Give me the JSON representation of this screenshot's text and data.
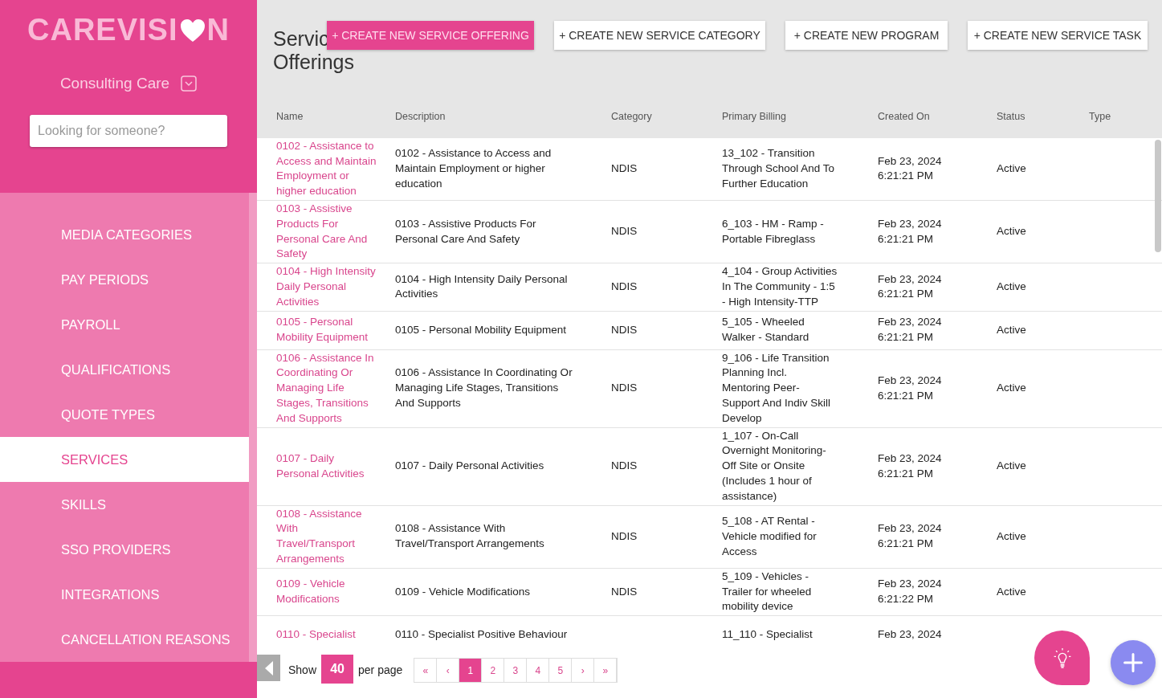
{
  "sidebar": {
    "logo": {
      "text_before": "CAREVISI",
      "text_after": "N"
    },
    "organisation": "Consulting Care",
    "search": {
      "placeholder": "Looking for someone?"
    },
    "items": [
      {
        "label": "MEDIA CATEGORIES",
        "selected": false
      },
      {
        "label": "PAY PERIODS",
        "selected": false
      },
      {
        "label": "PAYROLL",
        "selected": false
      },
      {
        "label": "QUALIFICATIONS",
        "selected": false
      },
      {
        "label": "QUOTE TYPES",
        "selected": false
      },
      {
        "label": "SERVICES",
        "selected": true
      },
      {
        "label": "SKILLS",
        "selected": false
      },
      {
        "label": "SSO PROVIDERS",
        "selected": false
      },
      {
        "label": "INTEGRATIONS",
        "selected": false
      },
      {
        "label": "CANCELLATION REASONS",
        "selected": false
      }
    ]
  },
  "page": {
    "title_lines": [
      "Servic",
      "Offerings"
    ],
    "buttons": [
      {
        "label": "+ CREATE NEW SERVICE OFFERING",
        "kind": "primary"
      },
      {
        "label": "+ CREATE NEW SERVICE CATEGORY",
        "kind": "secondary"
      },
      {
        "label": "+ CREATE NEW PROGRAM",
        "kind": "secondary"
      },
      {
        "label": "+ CREATE NEW SERVICE TASK",
        "kind": "secondary"
      }
    ]
  },
  "table": {
    "columns": [
      "Name",
      "Description",
      "Category",
      "Primary Billing",
      "Created On",
      "Status",
      "Type"
    ],
    "rows": [
      {
        "name": "0102 - Assistance to Access and Maintain Employment or higher education",
        "description": "0102 - Assistance to Access and Maintain Employment or higher education",
        "category": "NDIS",
        "billing": "13_102 - Transition Through School And To Further Education",
        "created": [
          "Feb 23, 2024",
          "6:21:21 PM"
        ],
        "status": "Active"
      },
      {
        "name": "0103 - Assistive Products For Personal Care And Safety",
        "description": "0103 - Assistive Products For Personal Care And Safety",
        "category": "NDIS",
        "billing": "6_103 - HM - Ramp - Portable Fibreglass",
        "created": [
          "Feb 23, 2024",
          "6:21:21 PM"
        ],
        "status": "Active"
      },
      {
        "name": "0104 - High Intensity Daily Personal Activities",
        "description": "0104 - High Intensity Daily Personal Activities",
        "category": "NDIS",
        "billing": "4_104 - Group Activities In The Community - 1:5 - High Intensity-TTP",
        "created": [
          "Feb 23, 2024",
          "6:21:21 PM"
        ],
        "status": "Active"
      },
      {
        "name": "0105 - Personal Mobility Equipment",
        "description": "0105 - Personal Mobility Equipment",
        "category": "NDIS",
        "billing": "5_105 - Wheeled Walker - Standard",
        "created": [
          "Feb 23, 2024",
          "6:21:21 PM"
        ],
        "status": "Active"
      },
      {
        "name": "0106 - Assistance In Coordinating Or Managing Life Stages, Transitions And Supports",
        "description": "0106 - Assistance In Coordinating Or Managing Life Stages, Transitions And Supports",
        "category": "NDIS",
        "billing": "9_106 - Life Transition Planning Incl. Mentoring Peer-Support And Indiv Skill Develop",
        "created": [
          "Feb 23, 2024",
          "6:21:21 PM"
        ],
        "status": "Active"
      },
      {
        "name": "0107 - Daily Personal Activities",
        "description": "0107 - Daily Personal Activities",
        "category": "NDIS",
        "billing": "1_107 - On-Call Overnight Monitoring-Off Site or Onsite (Includes 1 hour of assistance)",
        "created": [
          "Feb 23, 2024",
          "6:21:21 PM"
        ],
        "status": "Active"
      },
      {
        "name": "0108 - Assistance With Travel/Transport Arrangements",
        "description": "0108 - Assistance With Travel/Transport Arrangements",
        "category": "NDIS",
        "billing": "5_108 - AT Rental - Vehicle modified for Access",
        "created": [
          "Feb 23, 2024",
          "6:21:21 PM"
        ],
        "status": "Active"
      },
      {
        "name": "0109 - Vehicle Modifications",
        "description": "0109 - Vehicle Modifications",
        "category": "NDIS",
        "billing": "5_109 - Vehicles - Trailer for wheeled mobility device",
        "created": [
          "Feb 23, 2024",
          "6:21:22 PM"
        ],
        "status": "Active"
      },
      {
        "name": "0110 - Specialist",
        "description": "0110 - Specialist Positive Behaviour",
        "billing": "11_110 - Specialist",
        "created": [
          "Feb 23, 2024"
        ]
      }
    ]
  },
  "pagination": {
    "show_label": "Show",
    "per_page": "40",
    "per_page_label": "per page",
    "pages": [
      {
        "label": "«",
        "selected": false
      },
      {
        "label": "‹",
        "selected": false
      },
      {
        "label": "1",
        "selected": true
      },
      {
        "label": "2",
        "selected": false
      },
      {
        "label": "3",
        "selected": false
      },
      {
        "label": "4",
        "selected": false
      },
      {
        "label": "5",
        "selected": false
      },
      {
        "label": "›",
        "selected": false
      },
      {
        "label": "»",
        "selected": false
      }
    ]
  }
}
